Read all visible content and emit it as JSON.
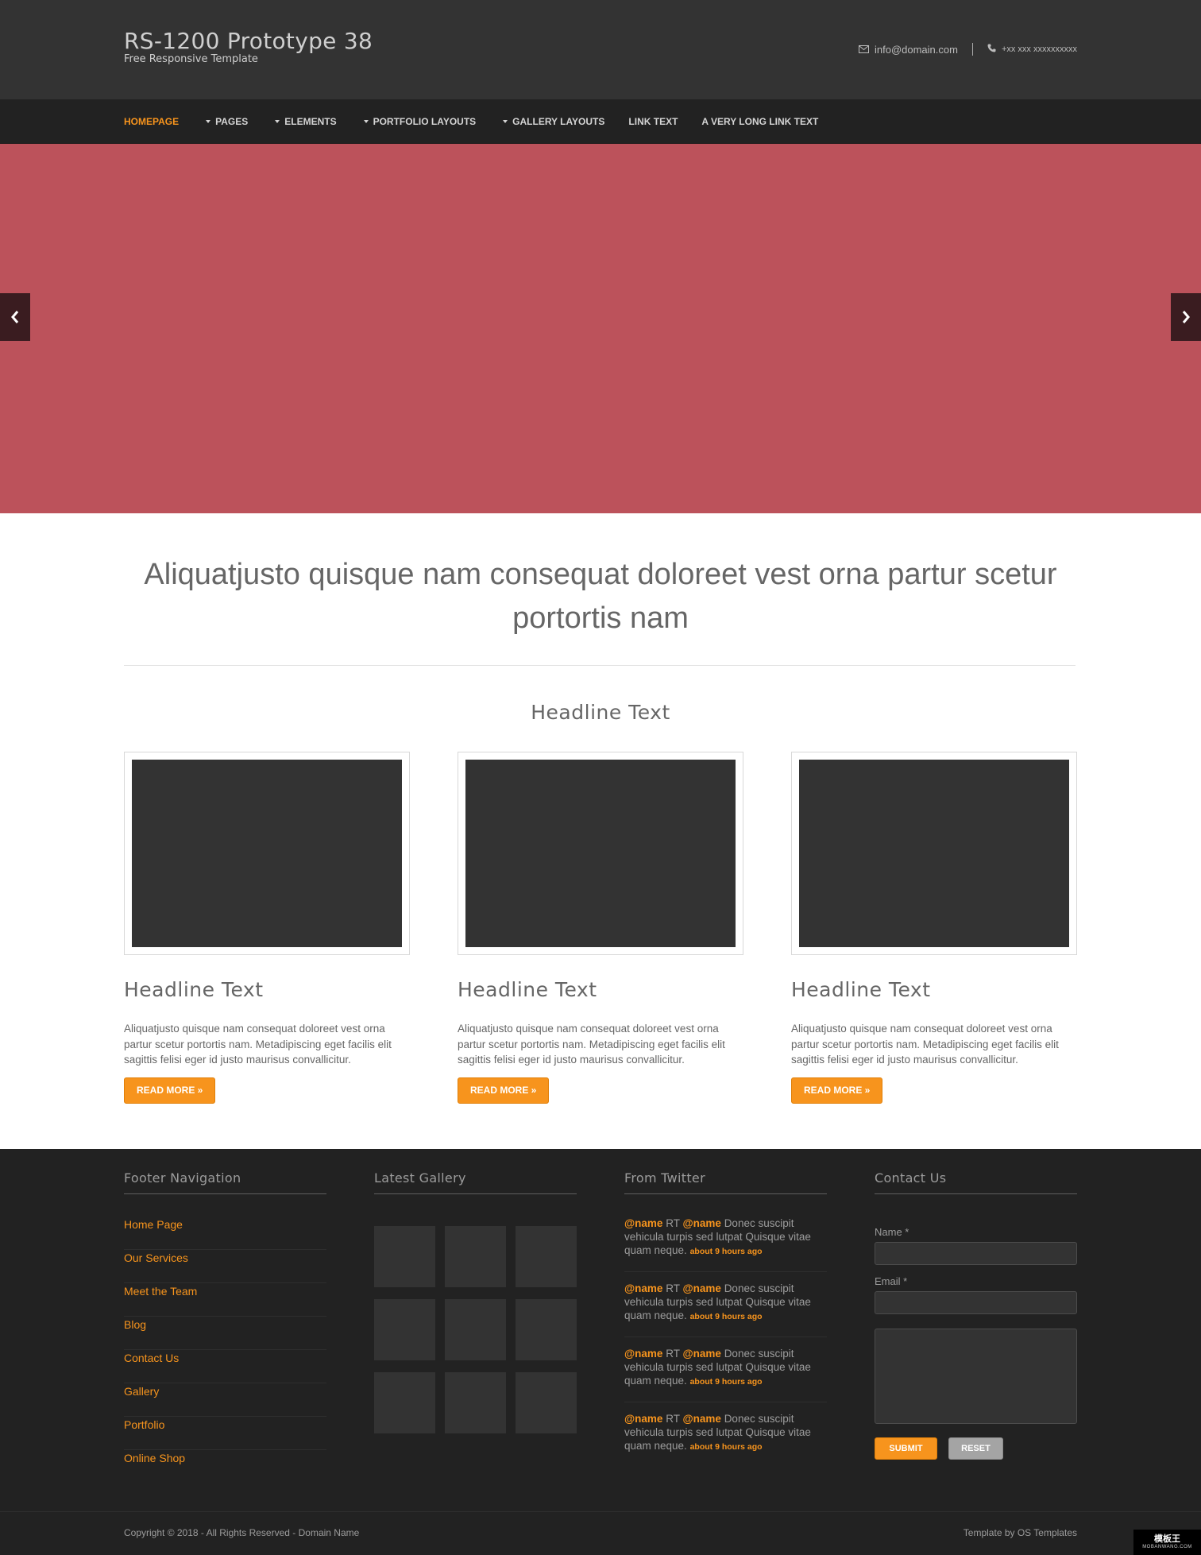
{
  "header": {
    "title": "RS-1200 Prototype 38",
    "subtitle": "Free Responsive Template",
    "email": "info@domain.com",
    "phone": "+xx xxx xxxxxxxxxx"
  },
  "nav": {
    "items": [
      {
        "label": "Homepage",
        "dropdown": false,
        "active": true
      },
      {
        "label": "Pages",
        "dropdown": true,
        "active": false
      },
      {
        "label": "Elements",
        "dropdown": true,
        "active": false
      },
      {
        "label": "Portfolio Layouts",
        "dropdown": true,
        "active": false
      },
      {
        "label": "Gallery Layouts",
        "dropdown": true,
        "active": false
      },
      {
        "label": "Link Text",
        "dropdown": false,
        "active": false
      },
      {
        "label": "A Very Long Link Text",
        "dropdown": false,
        "active": false
      }
    ]
  },
  "slider": {
    "prev_glyph": "‹",
    "next_glyph": "›",
    "bg_color": "#bc525b"
  },
  "intro": {
    "text": "Aliquatjusto quisque nam consequat doloreet vest orna partur scetur portortis nam"
  },
  "section": {
    "headline": "Headline Text"
  },
  "cards": [
    {
      "title": "Headline Text",
      "text": "Aliquatjusto quisque nam consequat doloreet vest orna partur scetur portortis nam. Metadipiscing eget facilis elit sagittis felisi eger id justo maurisus convallicitur.",
      "button": "Read More »"
    },
    {
      "title": "Headline Text",
      "text": "Aliquatjusto quisque nam consequat doloreet vest orna partur scetur portortis nam. Metadipiscing eget facilis elit sagittis felisi eger id justo maurisus convallicitur.",
      "button": "Read More »"
    },
    {
      "title": "Headline Text",
      "text": "Aliquatjusto quisque nam consequat doloreet vest orna partur scetur portortis nam. Metadipiscing eget facilis elit sagittis felisi eger id justo maurisus convallicitur.",
      "button": "Read More »"
    }
  ],
  "footer": {
    "nav_title": "Footer Navigation",
    "nav_items": [
      "Home Page",
      "Our Services",
      "Meet the Team",
      "Blog",
      "Contact Us",
      "Gallery",
      "Portfolio",
      "Online Shop"
    ],
    "gallery_title": "Latest Gallery",
    "twitter_title": "From Twitter",
    "tweets": [
      {
        "handle1": "@name",
        "rt": "RT",
        "handle2": "@name",
        "text": "Donec suscipit vehicula turpis sed lutpat Quisque vitae quam neque.",
        "time": "about 9 hours ago"
      },
      {
        "handle1": "@name",
        "rt": "RT",
        "handle2": "@name",
        "text": "Donec suscipit vehicula turpis sed lutpat Quisque vitae quam neque.",
        "time": "about 9 hours ago"
      },
      {
        "handle1": "@name",
        "rt": "RT",
        "handle2": "@name",
        "text": "Donec suscipit vehicula turpis sed lutpat Quisque vitae quam neque.",
        "time": "about 9 hours ago"
      },
      {
        "handle1": "@name",
        "rt": "RT",
        "handle2": "@name",
        "text": "Donec suscipit vehicula turpis sed lutpat Quisque vitae quam neque.",
        "time": "about 9 hours ago"
      }
    ],
    "contact_title": "Contact Us",
    "form": {
      "name_label": "Name *",
      "email_label": "Email *",
      "name_value": "",
      "email_value": "",
      "message_value": "",
      "submit_label": "Submit",
      "reset_label": "Reset"
    }
  },
  "copyright": {
    "left": "Copyright © 2018 - All Rights Reserved - Domain Name",
    "right_prefix": "Template by",
    "right_link": "OS Templates"
  },
  "watermark": {
    "top": "模板王",
    "bottom": "MOBANWANG.COM"
  },
  "colors": {
    "accent": "#f7941d",
    "header_bg": "#333333",
    "nav_bg": "#222222",
    "footer_bg": "#222222"
  },
  "icons": {
    "email": "envelope-icon",
    "phone": "phone-icon",
    "prev": "chevron-left-icon",
    "next": "chevron-right-icon"
  }
}
